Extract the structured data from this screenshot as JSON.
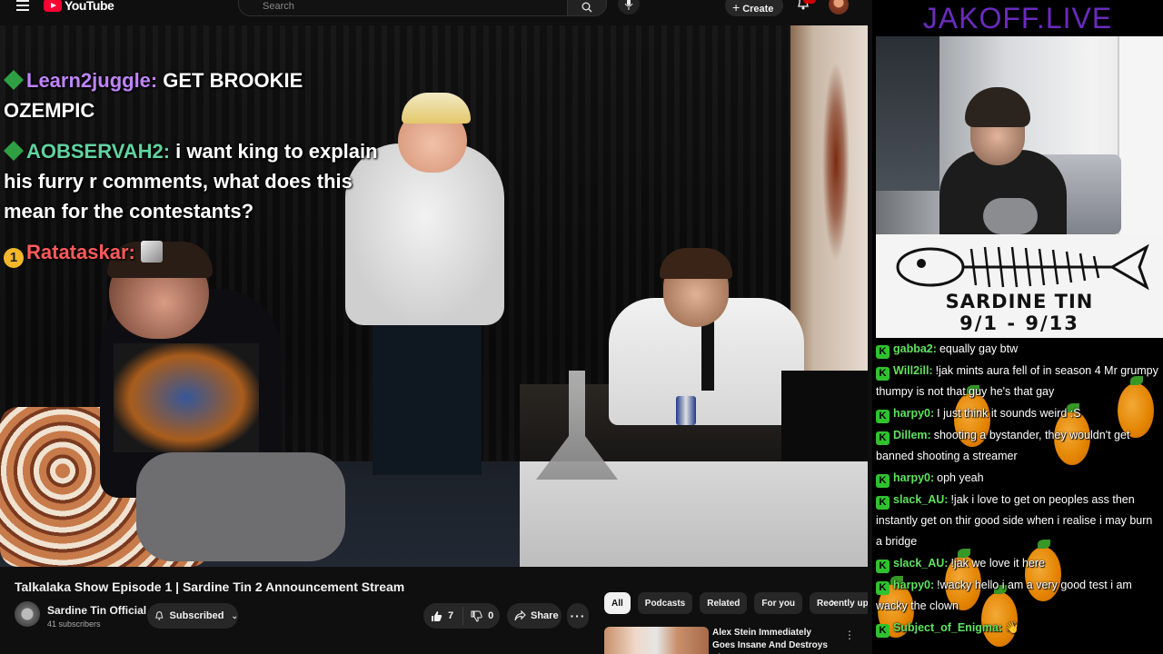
{
  "header": {
    "logo_text": "YouTube",
    "search_placeholder": "Search",
    "create_label": "Create",
    "notifications_badge": "9+"
  },
  "video_overlay_chat": [
    {
      "badge": "diamond",
      "user": "Learn2juggle:",
      "text": "GET BROOKIE OZEMPIC",
      "user_color": "#c084fc"
    },
    {
      "badge": "diamond",
      "user": "AOBSERVAH2:",
      "text": "i want king to explain his furry r comments, what does this mean for the contestants?",
      "user_color": "#5fd3a0"
    },
    {
      "badge": "tier",
      "badge_text": "1",
      "user": "Ratataskar:",
      "text": "",
      "user_color": "#ff5a5a"
    }
  ],
  "video_info": {
    "title": "Talkalaka Show Episode 1 | Sardine Tin 2 Announcement Stream",
    "channel_name": "Sardine Tin Official",
    "subscribers": "41 subscribers",
    "subscribe_label": "Subscribed",
    "likes": "7",
    "dislikes": "0",
    "share_label": "Share"
  },
  "chips": [
    "All",
    "Podcasts",
    "Related",
    "For you",
    "Recently uploaded"
  ],
  "recommended": {
    "title": "Alex Stein Immediately Goes Insane And Destroys The ..."
  },
  "stream": {
    "site_name": "JAKOFF.LIVE",
    "event_title": "SARDINE TIN",
    "event_dates": "9/1 - 9/13",
    "chat": [
      {
        "user": "gabba2:",
        "text": "equally gay btw"
      },
      {
        "user": "Will2ill:",
        "text": "!jak mints aura fell of in season 4 Mr grumpy thumpy is not that guy he's that gay"
      },
      {
        "user": "harpy0:",
        "text": "I just think it sounds weird :S"
      },
      {
        "user": "Dillem:",
        "text": "shooting a bystander, they wouldn't get banned shooting a streamer"
      },
      {
        "user": "harpy0:",
        "text": "oph yeah"
      },
      {
        "user": "slack_AU:",
        "text": "!jak i love to get on peoples ass then instantly get on thir good side when i realise i may burn a bridge"
      },
      {
        "user": "slack_AU:",
        "text": "!jak we love it here"
      },
      {
        "user": "harpy0:",
        "text": "!wacky hello i am a very good test i am wacky the clown"
      },
      {
        "user": "Subject_of_Enigma:",
        "text": "👋"
      }
    ]
  },
  "colors": {
    "yt_red": "#ff0033",
    "chat_user_green": "#5fe35f",
    "site_banner_purple": "#6a2bbf"
  }
}
